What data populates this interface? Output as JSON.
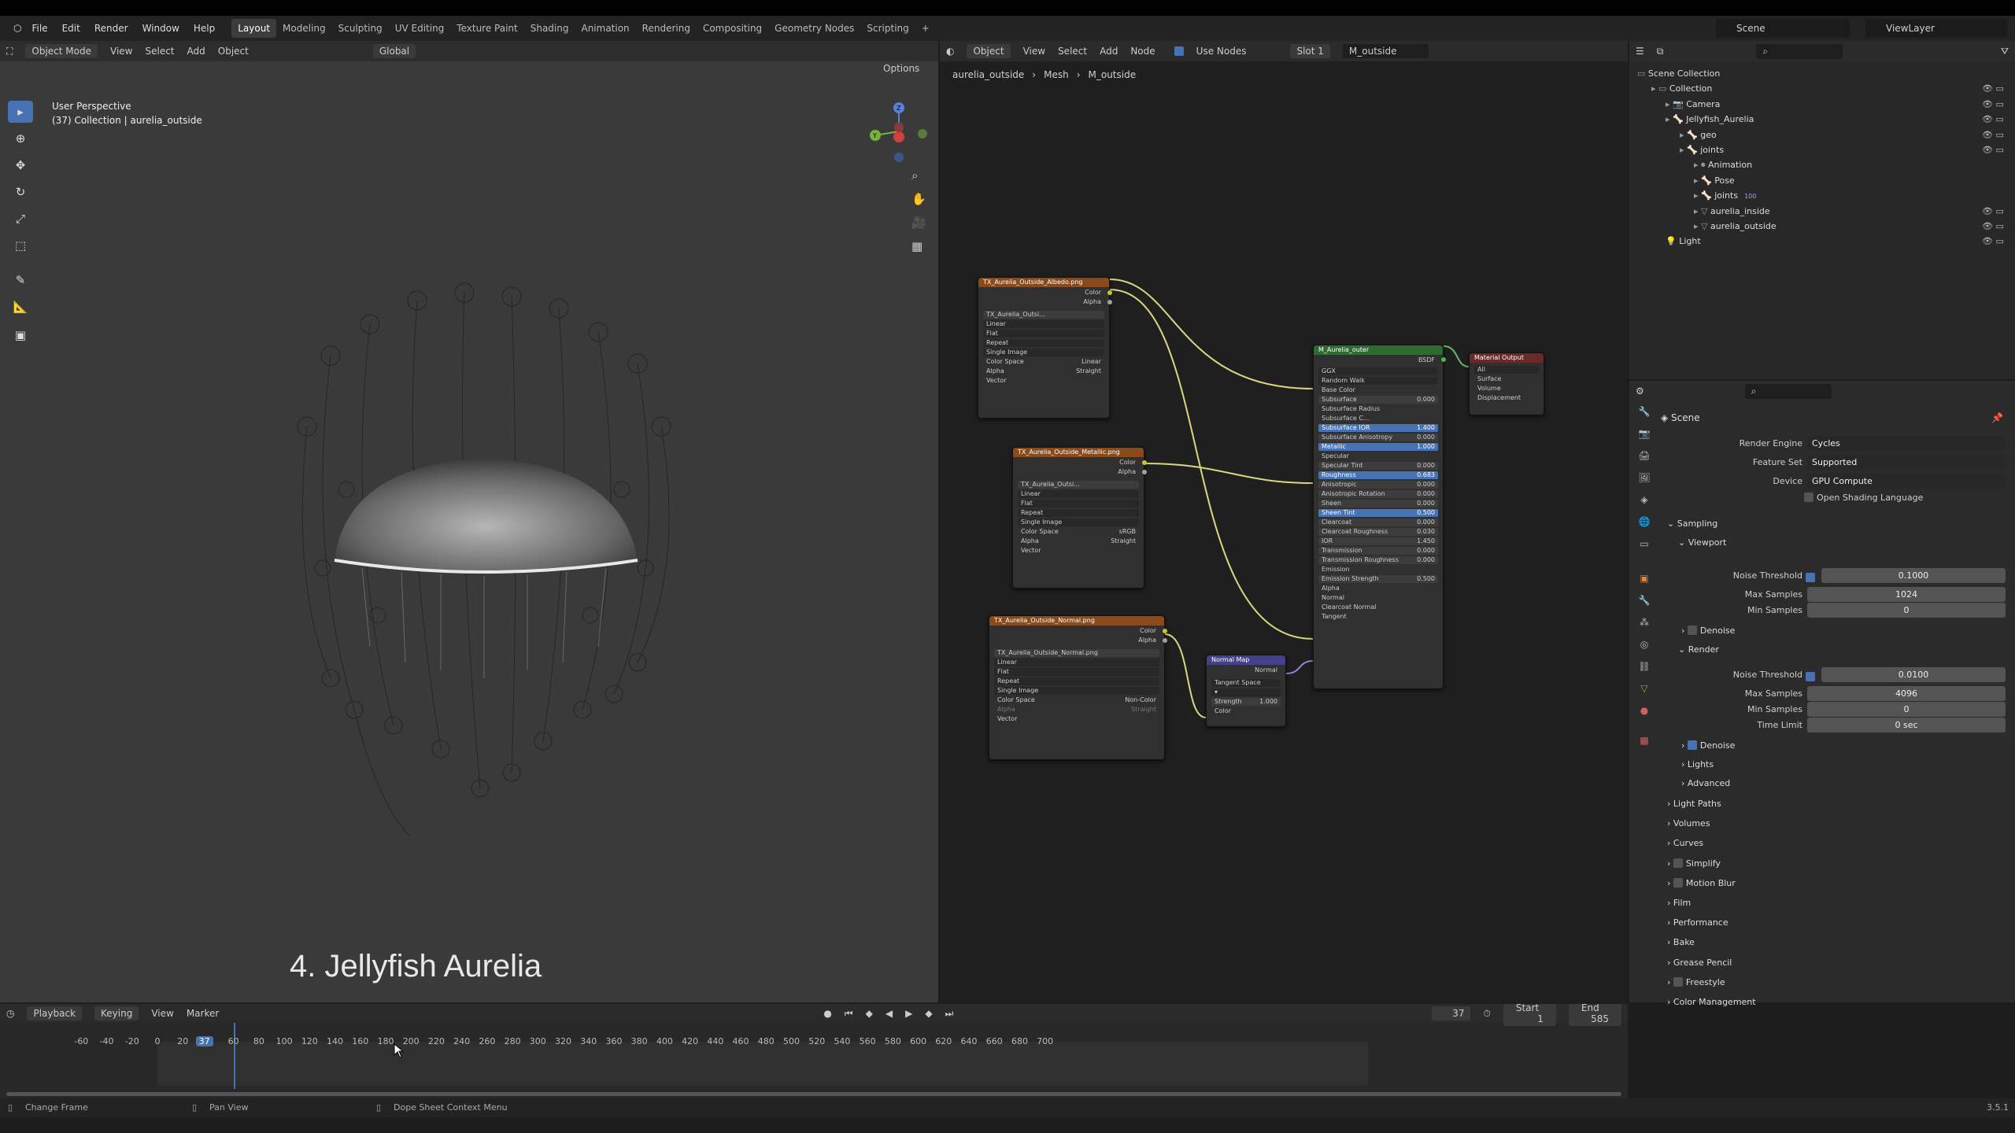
{
  "menu": [
    "File",
    "Edit",
    "Render",
    "Window",
    "Help"
  ],
  "workspaces": [
    "Layout",
    "Modeling",
    "Sculpting",
    "UV Editing",
    "Texture Paint",
    "Shading",
    "Animation",
    "Rendering",
    "Compositing",
    "Geometry Nodes",
    "Scripting",
    "+"
  ],
  "topbar_right": {
    "scene": "Scene",
    "view_layer": "ViewLayer"
  },
  "viewport": {
    "mode": "Object Mode",
    "menus": [
      "View",
      "Select",
      "Add",
      "Object"
    ],
    "transform": "Global",
    "options": "Options",
    "perspective": "User Perspective",
    "collection_info": "(37) Collection | aurelia_outside",
    "overlay_title": "4. Jellyfish Aurelia"
  },
  "node_editor": {
    "type": "Object",
    "menus": [
      "View",
      "Select",
      "Add",
      "Node"
    ],
    "use_nodes": "Use Nodes",
    "slot": "Slot 1",
    "material": "M_outside",
    "breadcrumb": [
      "aurelia_outside",
      "Mesh",
      "M_outside"
    ],
    "nodes": {
      "albedo": {
        "title": "TX_Aurelia_Outside_Albedo.png",
        "outputs": [
          "Color",
          "Alpha"
        ],
        "image": "TX_Aurelia_Outsi...",
        "rows": [
          "Linear",
          "Flat",
          "Repeat",
          "Single Image"
        ],
        "color_space_label": "Color Space",
        "color_space": "Linear",
        "alpha_label": "Alpha",
        "alpha": "Straight",
        "input": "Vector"
      },
      "metallic": {
        "title": "TX_Aurelia_Outside_Metallic.png",
        "outputs": [
          "Color",
          "Alpha"
        ],
        "image": "TX_Aurelia_Outsi...",
        "rows": [
          "Linear",
          "Flat",
          "Repeat",
          "Single Image"
        ],
        "color_space_label": "Color Space",
        "color_space": "sRGB",
        "alpha_label": "Alpha",
        "alpha": "Straight",
        "input": "Vector"
      },
      "normal_tex": {
        "title": "TX_Aurelia_Outside_Normal.png",
        "outputs": [
          "Color",
          "Alpha"
        ],
        "image": "TX_Aurelia_Outside_Normal.png",
        "rows": [
          "Linear",
          "Flat",
          "Repeat",
          "Single Image"
        ],
        "color_space_label": "Color Space",
        "color_space": "Non-Color",
        "alpha_label": "Alpha",
        "alpha": "Straight",
        "input": "Vector"
      },
      "normal_map": {
        "title": "Normal Map",
        "output": "Normal",
        "space": "Tangent Space",
        "strength_label": "Strength",
        "strength": "1.000",
        "input": "Color"
      },
      "principled": {
        "title": "M_Aurelia_outer",
        "output": "BSDF",
        "dist": "GGX",
        "sss": "Random Walk",
        "base_color": "Base Color",
        "rows": [
          {
            "label": "Subsurface",
            "value": "0.000",
            "hi": false
          },
          {
            "label": "Subsurface Radius",
            "value": "",
            "hi": false
          },
          {
            "label": "Subsurface C...",
            "value": "",
            "hi": false
          },
          {
            "label": "Subsurface IOR",
            "value": "1.400",
            "hi": true
          },
          {
            "label": "Subsurface Anisotropy",
            "value": "0.000",
            "hi": false
          },
          {
            "label": "Metallic",
            "value": "1.000",
            "hi": true
          },
          {
            "label": "Specular",
            "value": "",
            "hi": false
          },
          {
            "label": "Specular Tint",
            "value": "0.000",
            "hi": false
          },
          {
            "label": "Roughness",
            "value": "0.683",
            "hi": true
          },
          {
            "label": "Anisotropic",
            "value": "0.000",
            "hi": false
          },
          {
            "label": "Anisotropic Rotation",
            "value": "0.000",
            "hi": false
          },
          {
            "label": "Sheen",
            "value": "0.000",
            "hi": false
          },
          {
            "label": "Sheen Tint",
            "value": "0.500",
            "hi": true
          },
          {
            "label": "Clearcoat",
            "value": "0.000",
            "hi": false
          },
          {
            "label": "Clearcoat Roughness",
            "value": "0.030",
            "hi": false
          },
          {
            "label": "IOR",
            "value": "1.450",
            "hi": false
          },
          {
            "label": "Transmission",
            "value": "0.000",
            "hi": false
          },
          {
            "label": "Transmission Roughness",
            "value": "0.000",
            "hi": false
          },
          {
            "label": "Emission",
            "value": "",
            "hi": false
          },
          {
            "label": "Emission Strength",
            "value": "0.500",
            "hi": false
          },
          {
            "label": "Alpha",
            "value": "",
            "hi": false
          },
          {
            "label": "Normal",
            "value": "",
            "hi": false
          },
          {
            "label": "Clearcoat Normal",
            "value": "",
            "hi": false
          },
          {
            "label": "Tangent",
            "value": "",
            "hi": false
          }
        ]
      },
      "output": {
        "title": "Material Output",
        "target": "All",
        "inputs": [
          "Surface",
          "Volume",
          "Displacement"
        ]
      }
    }
  },
  "outliner": {
    "items": [
      {
        "label": "Scene Collection",
        "depth": 0
      },
      {
        "label": "Collection",
        "depth": 1
      },
      {
        "label": "Camera",
        "depth": 2
      },
      {
        "label": "Jellyfish_Aurelia",
        "depth": 2
      },
      {
        "label": "geo",
        "depth": 3
      },
      {
        "label": "joints",
        "depth": 3
      },
      {
        "label": "Animation",
        "depth": 4
      },
      {
        "label": "Pose",
        "depth": 4
      },
      {
        "label": "joints",
        "depth": 4
      },
      {
        "label": "aurelia_inside",
        "depth": 4
      },
      {
        "label": "aurelia_outside",
        "depth": 4
      },
      {
        "label": "Light",
        "depth": 2
      }
    ],
    "joints_badge": "100"
  },
  "properties": {
    "context": "Scene",
    "render_engine_label": "Render Engine",
    "render_engine": "Cycles",
    "feature_set_label": "Feature Set",
    "feature_set": "Supported",
    "device_label": "Device",
    "device": "GPU Compute",
    "osl": "Open Shading Language",
    "sampling": "Sampling",
    "viewport": "Viewport",
    "vp_noise_label": "Noise Threshold",
    "vp_noise": "0.1000",
    "vp_max_label": "Max Samples",
    "vp_max": "1024",
    "vp_min_label": "Min Samples",
    "vp_min": "0",
    "denoise": "Denoise",
    "render": "Render",
    "r_noise_label": "Noise Threshold",
    "r_noise": "0.0100",
    "r_max_label": "Max Samples",
    "r_max": "4096",
    "r_min_label": "Min Samples",
    "r_min": "0",
    "r_time_label": "Time Limit",
    "r_time": "0 sec",
    "r_denoise": "Denoise",
    "lights": "Lights",
    "advanced": "Advanced",
    "panels": [
      "Light Paths",
      "Volumes",
      "Curves",
      "Simplify",
      "Motion Blur",
      "Film",
      "Performance",
      "Bake",
      "Grease Pencil",
      "Freestyle",
      "Color Management"
    ]
  },
  "timeline": {
    "menus": [
      "Playback",
      "Keying",
      "View",
      "Marker"
    ],
    "current_frame": "37",
    "start_label": "Start",
    "start": "1",
    "end_label": "End",
    "end": "585",
    "ticks": [
      "-60",
      "-40",
      "-20",
      "0",
      "20",
      "37",
      "60",
      "80",
      "100",
      "120",
      "140",
      "160",
      "180",
      "200",
      "220",
      "240",
      "260",
      "280",
      "300",
      "320",
      "340",
      "360",
      "380",
      "400",
      "420",
      "440",
      "460",
      "480",
      "500",
      "520",
      "540",
      "560",
      "580",
      "600",
      "620",
      "640",
      "660",
      "680",
      "700"
    ]
  },
  "statusbar": {
    "items": [
      "Change Frame",
      "Pan View",
      "Dope Sheet Context Menu"
    ],
    "version": "3.5.1"
  },
  "colors": {
    "accent": "#4772b3",
    "node_texture": "#8a4a1a",
    "node_shader": "#2f6b31",
    "node_output": "#6b2a2a",
    "node_vector": "#44418a",
    "link": "#d8d880"
  }
}
